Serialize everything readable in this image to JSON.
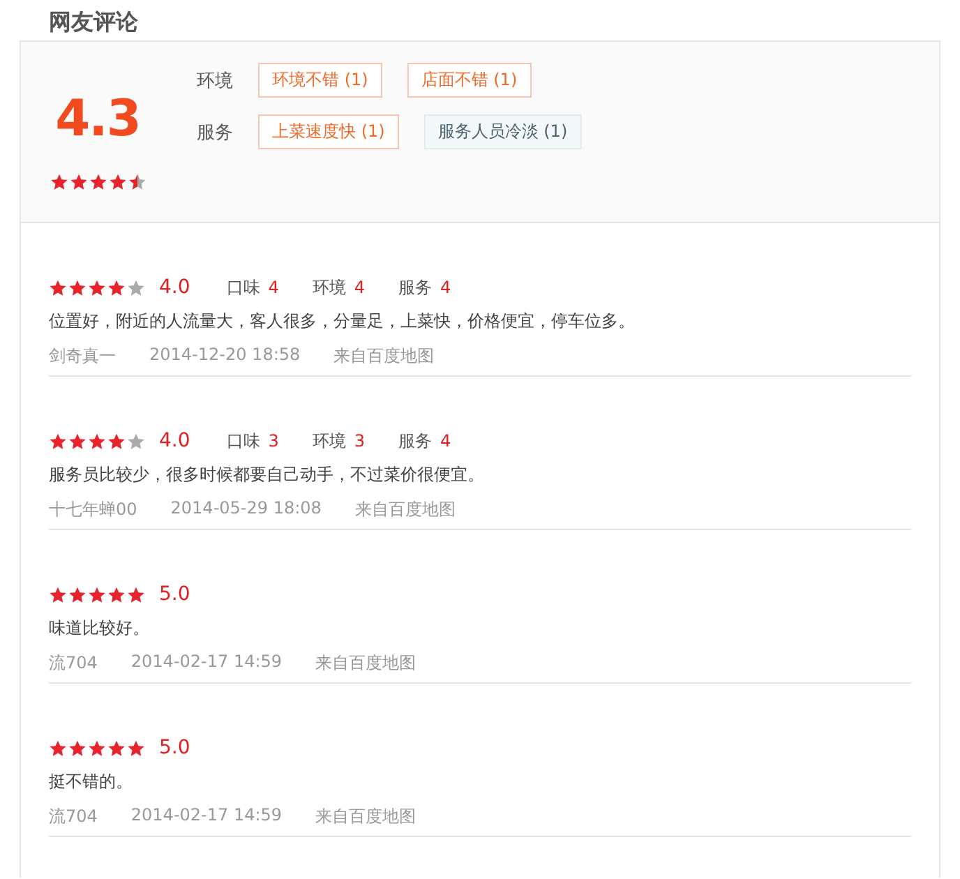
{
  "title": "网友评论",
  "summary": {
    "score": "4.3",
    "stars": 4.5,
    "groups": [
      {
        "label": "环境",
        "tags": [
          {
            "text": "环境不错 (1)",
            "kind": "positive"
          },
          {
            "text": "店面不错 (1)",
            "kind": "positive"
          }
        ]
      },
      {
        "label": "服务",
        "tags": [
          {
            "text": "上菜速度快 (1)",
            "kind": "positive"
          },
          {
            "text": "服务人员冷淡 (1)",
            "kind": "negative"
          }
        ]
      }
    ]
  },
  "reviews": [
    {
      "stars": 4,
      "score": "4.0",
      "aspects": [
        {
          "label": "口味",
          "value": "4"
        },
        {
          "label": "环境",
          "value": "4"
        },
        {
          "label": "服务",
          "value": "4"
        }
      ],
      "text": "位置好，附近的人流量大，客人很多，分量足，上菜快，价格便宜，停车位多。",
      "user": "剑奇真一",
      "time": "2014-12-20 18:58",
      "source": "来自百度地图"
    },
    {
      "stars": 4,
      "score": "4.0",
      "aspects": [
        {
          "label": "口味",
          "value": "3"
        },
        {
          "label": "环境",
          "value": "3"
        },
        {
          "label": "服务",
          "value": "4"
        }
      ],
      "text": "服务员比较少，很多时候都要自己动手，不过菜价很便宜。",
      "user": "十七年蝉00",
      "time": "2014-05-29 18:08",
      "source": "来自百度地图"
    },
    {
      "stars": 5,
      "score": "5.0",
      "text": "味道比较好。",
      "user": "流704",
      "time": "2014-02-17 14:59",
      "source": "来自百度地图"
    },
    {
      "stars": 5,
      "score": "5.0",
      "text": "挺不错的。",
      "user": "流704",
      "time": "2014-02-17 14:59",
      "source": "来自百度地图"
    }
  ]
}
